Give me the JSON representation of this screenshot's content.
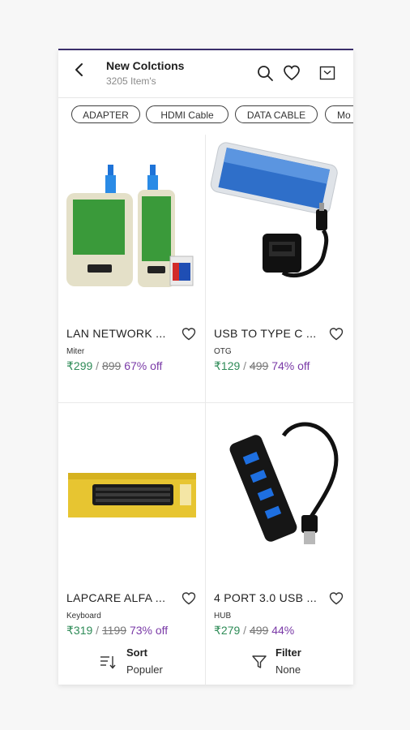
{
  "header": {
    "title": "New Colctions",
    "subtitle": "3205 Item's",
    "icons": [
      "back-arrow-icon",
      "search-icon",
      "heart-icon",
      "inbox-icon"
    ]
  },
  "chips": [
    "ADAPTER",
    "HDMI Cable",
    "DATA CABLE",
    "Mo"
  ],
  "products": [
    {
      "name": "LAN NETWORK ...",
      "category": "Miter",
      "price": "₹299",
      "mrp": "899",
      "off": "67% off"
    },
    {
      "name": "USB TO TYPE C ...",
      "category": "OTG",
      "price": "₹129",
      "mrp": "499",
      "off": "74% off"
    },
    {
      "name": "LAPCARE ALFA ...",
      "category": "Keyboard",
      "price": "₹319",
      "mrp": "1199",
      "off": "73% off"
    },
    {
      "name": "4 PORT 3.0 USB ...",
      "category": "HUB",
      "price": "₹279",
      "mrp": "499",
      "off": "44%"
    }
  ],
  "bottom": {
    "sort_label": "Sort",
    "sort_value": "Populer",
    "filter_label": "Filter",
    "filter_value": "None"
  },
  "colors": {
    "accent": "#3a2e6b",
    "price": "#2e8b57",
    "discount": "#7a3aa7"
  }
}
